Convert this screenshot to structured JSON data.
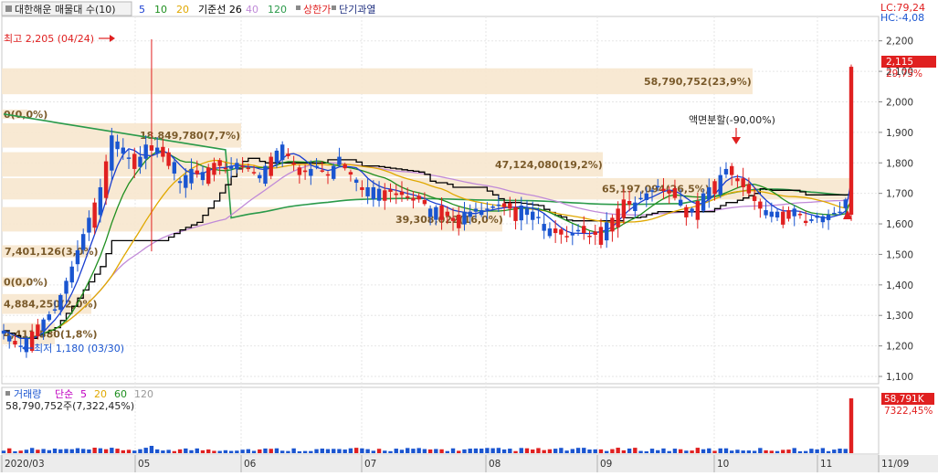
{
  "header": {
    "stock_name": "대한해운 매물대 수(10)",
    "ma_labels": [
      {
        "text": "5",
        "color": "#1a3fd1"
      },
      {
        "text": "10",
        "color": "#1f8f1f"
      },
      {
        "text": "20",
        "color": "#e0a800"
      },
      {
        "text": "기준선 26",
        "color": "#000000"
      },
      {
        "text": "40",
        "color": "#c08ad8"
      },
      {
        "text": "120",
        "color": "#2a9a4a"
      },
      {
        "text": "상한가",
        "color": "#e02020"
      },
      {
        "text": "단기과열",
        "color": "#203080"
      }
    ],
    "lc": "LC:79,24",
    "hc": "HC:-4,08"
  },
  "annotations": {
    "high": "최고 2,205 (04/24)",
    "low": "최저 1,180 (03/30)",
    "split": "액면분할(-90,00%)"
  },
  "price_axis": {
    "ticks": [
      "2,200",
      "2,100",
      "2,000",
      "1,900",
      "1,800",
      "1,700",
      "1,600",
      "1,500",
      "1,400",
      "1,300",
      "1,200",
      "1,100"
    ],
    "current_price": "2,115",
    "current_change": "29,75%"
  },
  "volume_panel": {
    "title": "거래량",
    "sma_label": "단순",
    "ma_labels": [
      {
        "text": "5",
        "color": "#c000c0"
      },
      {
        "text": "20",
        "color": "#e0a800"
      },
      {
        "text": "60",
        "color": "#1f8f1f"
      },
      {
        "text": "120",
        "color": "#999999"
      }
    ],
    "info": "58,790,752주(7,322,45%)",
    "current_volume": "58,791K",
    "current_volume_pct": "7322,45%"
  },
  "x_axis": {
    "labels": [
      "2020/03",
      "05",
      "06",
      "07",
      "08",
      "09",
      "10",
      "11",
      "11/09"
    ]
  },
  "colors": {
    "up": "#e02020",
    "down": "#1a55d0",
    "band": "#f7e7cf",
    "band_text": "#7a5a2a",
    "ma5": "#1a3fd1",
    "ma10": "#1f8f1f",
    "ma20": "#e0a800",
    "base26": "#000000",
    "ma40": "#c08ad8",
    "ma120": "#2a9a4a"
  },
  "chart_data": {
    "type": "candlestick",
    "y_range": [
      1100,
      2250
    ],
    "volume_profile": [
      {
        "label": "58,790,752(23,9%)",
        "price_low": 2025,
        "price_high": 2110
      },
      {
        "label": "18,849,780(7,7%)",
        "price_low": 1850,
        "price_high": 1930
      },
      {
        "label": "47,124,080(19,2%)",
        "price_low": 1755,
        "price_high": 1835
      },
      {
        "label": "65,197,094(26,5%)",
        "price_low": 1680,
        "price_high": 1750
      },
      {
        "label": "39,308,022(16,0%)",
        "price_low": 1575,
        "price_high": 1655
      },
      {
        "label": "7,401,126(3,0%)",
        "price_low": 1490,
        "price_high": 1530
      },
      {
        "label": "0(0,0%)",
        "price_low": 1945,
        "price_high": 1975
      },
      {
        "label": "0(0,0%)",
        "price_low": 1395,
        "price_high": 1425
      },
      {
        "label": "4,884,250(2,0%)",
        "price_low": 1305,
        "price_high": 1370
      },
      {
        "label": "4,411,580(1,8%)",
        "price_low": 1205,
        "price_high": 1275
      }
    ],
    "price_path": [
      [
        0,
        1250
      ],
      [
        3,
        1200
      ],
      [
        6,
        1270
      ],
      [
        9,
        1320
      ],
      [
        12,
        1460
      ],
      [
        15,
        1620
      ],
      [
        17,
        1720
      ],
      [
        19,
        1890
      ],
      [
        21,
        1850
      ],
      [
        23,
        1780
      ],
      [
        25,
        1860
      ],
      [
        26,
        1840
      ],
      [
        27,
        1850
      ],
      [
        29,
        1790
      ],
      [
        31,
        1740
      ],
      [
        33,
        1780
      ],
      [
        35,
        1770
      ],
      [
        37,
        1800
      ],
      [
        39,
        1780
      ],
      [
        41,
        1800
      ],
      [
        43,
        1780
      ],
      [
        45,
        1760
      ],
      [
        47,
        1820
      ],
      [
        49,
        1860
      ],
      [
        51,
        1800
      ],
      [
        53,
        1770
      ],
      [
        55,
        1790
      ],
      [
        57,
        1760
      ],
      [
        59,
        1820
      ],
      [
        61,
        1770
      ],
      [
        63,
        1720
      ],
      [
        65,
        1720
      ],
      [
        67,
        1710
      ],
      [
        69,
        1700
      ],
      [
        71,
        1690
      ],
      [
        73,
        1680
      ],
      [
        75,
        1650
      ],
      [
        77,
        1660
      ],
      [
        79,
        1620
      ],
      [
        81,
        1640
      ],
      [
        83,
        1640
      ],
      [
        85,
        1650
      ],
      [
        87,
        1660
      ],
      [
        89,
        1650
      ],
      [
        91,
        1660
      ],
      [
        93,
        1640
      ],
      [
        95,
        1600
      ],
      [
        97,
        1570
      ],
      [
        99,
        1560
      ],
      [
        101,
        1580
      ],
      [
        103,
        1560
      ],
      [
        105,
        1590
      ],
      [
        107,
        1620
      ],
      [
        109,
        1680
      ],
      [
        111,
        1670
      ],
      [
        113,
        1700
      ],
      [
        115,
        1720
      ],
      [
        117,
        1710
      ],
      [
        119,
        1660
      ],
      [
        121,
        1650
      ],
      [
        123,
        1700
      ],
      [
        125,
        1740
      ],
      [
        127,
        1780
      ],
      [
        129,
        1740
      ],
      [
        131,
        1700
      ],
      [
        133,
        1650
      ],
      [
        135,
        1640
      ],
      [
        137,
        1640
      ],
      [
        139,
        1650
      ],
      [
        141,
        1610
      ],
      [
        143,
        1620
      ],
      [
        145,
        1630
      ],
      [
        147,
        1640
      ],
      [
        148,
        1680
      ],
      [
        149,
        2115
      ]
    ]
  }
}
